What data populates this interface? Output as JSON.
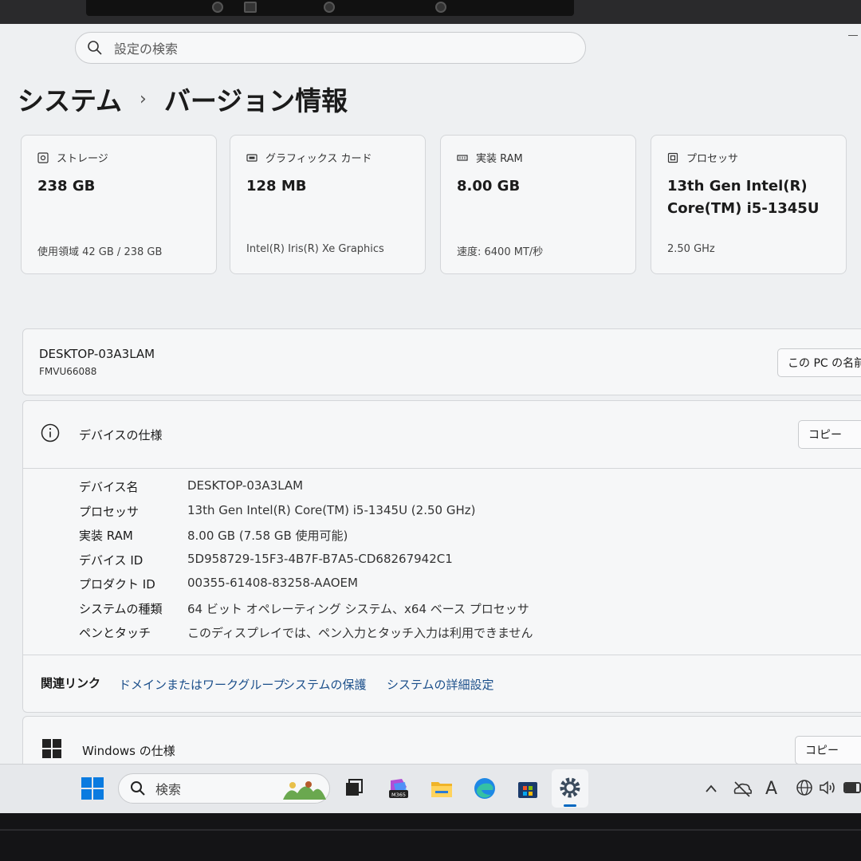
{
  "search": {
    "placeholder": "設定の検索"
  },
  "breadcrumb": {
    "parent": "システム",
    "separator": "›",
    "current": "バージョン情報"
  },
  "cards": [
    {
      "title": "ストレージ",
      "value": "238 GB",
      "sub": "使用領域 42 GB / 238 GB",
      "icon": "storage-icon"
    },
    {
      "title": "グラフィックス カード",
      "value": "128 MB",
      "sub": "Intel(R) Iris(R) Xe Graphics",
      "icon": "graphics-card-icon"
    },
    {
      "title": "実装 RAM",
      "value": "8.00 GB",
      "sub": "速度: 6400 MT/秒",
      "icon": "ram-icon"
    },
    {
      "title": "プロセッサ",
      "value": "13th Gen Intel(R) Core(TM) i5-1345U",
      "sub": "2.50 GHz",
      "icon": "processor-icon"
    }
  ],
  "device": {
    "name": "DESKTOP-03A3LAM",
    "model": "FMVU66088",
    "rename_button": "この PC の名前を変更"
  },
  "device_spec": {
    "title": "デバイスの仕様",
    "copy_button": "コピー",
    "rows": [
      {
        "key": "デバイス名",
        "value": "DESKTOP-03A3LAM"
      },
      {
        "key": "プロセッサ",
        "value": "13th Gen Intel(R) Core(TM) i5-1345U (2.50 GHz)"
      },
      {
        "key": "実装 RAM",
        "value": "8.00 GB (7.58 GB 使用可能)"
      },
      {
        "key": "デバイス ID",
        "value": "5D958729-15F3-4B7F-B7A5-CD68267942C1"
      },
      {
        "key": "プロダクト ID",
        "value": "00355-61408-83258-AAOEM"
      },
      {
        "key": "システムの種類",
        "value": "64 ビット オペレーティング システム、x64 ベース プロセッサ"
      },
      {
        "key": "ペンとタッチ",
        "value": "このディスプレイでは、ペン入力とタッチ入力は利用できません"
      }
    ]
  },
  "related_links": {
    "label": "関連リンク",
    "links": [
      "ドメインまたはワークグループ",
      "システムの保護",
      "システムの詳細設定"
    ]
  },
  "windows_spec": {
    "title": "Windows の仕様",
    "copy_button": "コピー"
  },
  "taskbar": {
    "search_placeholder": "検索",
    "apps": [
      "start-icon",
      "task-view-icon",
      "m365-copilot-icon",
      "file-explorer-icon",
      "edge-icon",
      "microsoft-store-icon",
      "settings-icon"
    ],
    "m365_label": "M365",
    "tray": [
      "chevron-up-icon",
      "onedrive-icon",
      "ime-icon",
      "network-icon",
      "volume-icon",
      "battery-icon"
    ],
    "ime_label": "A"
  },
  "colors": {
    "link": "#1a4e8a",
    "accent": "#0067c0"
  }
}
